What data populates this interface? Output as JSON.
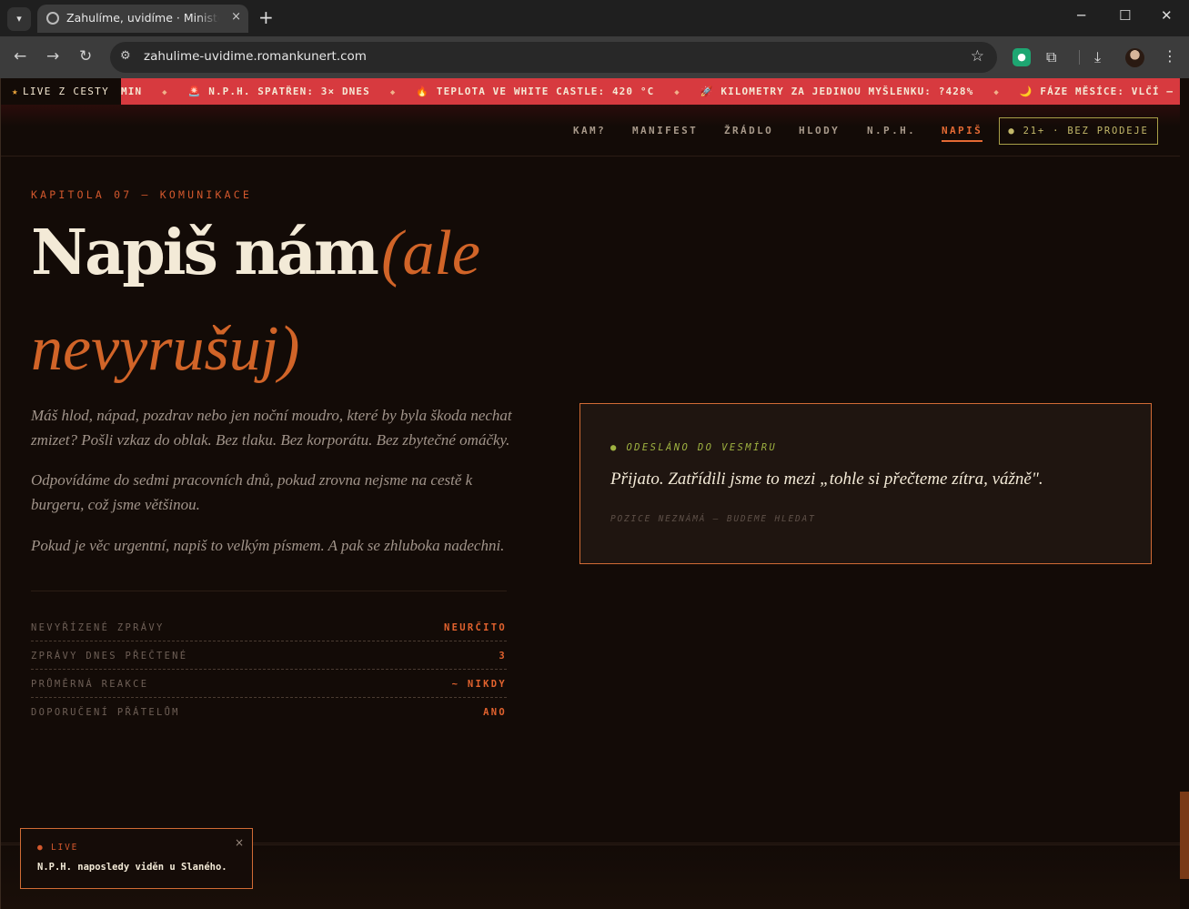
{
  "browser": {
    "tab_title": "Zahulíme, uvidíme · Ministerstvo",
    "tab_close": "×",
    "new_tab": "+",
    "url": "zahulime-uvidime.romankunert.com",
    "win_min": "─",
    "win_max": "☐",
    "win_close": "✕"
  },
  "ticker": {
    "label": "LIVE Z CESTY",
    "items": [
      "MIN",
      "🚨 N.P.H. SPATŘEN: 3× DNES",
      "🔥 TEPLOTA VE WHITE CASTLE: 420 °C",
      "🚀 KILOMETRY ZA JEDINOU MYŠLENKU: ?428%",
      "🌙 FÁZE MĚSÍCE: VLČÍ —"
    ]
  },
  "nav": {
    "items": [
      "KAM?",
      "MANIFEST",
      "ŽRÁDLO",
      "HLODY",
      "N.P.H.",
      "NAPIŠ"
    ],
    "active": "NAPIŠ",
    "age_badge": "● 21+ · BEZ PRODEJE"
  },
  "hero": {
    "kicker": "KAPITOLA 07 — KOMUNIKACE",
    "title": "Napiš nám",
    "title_aside": "(ale nevyrušuj)"
  },
  "paragraphs": [
    "Máš hlod, nápad, pozdrav nebo jen noční moudro, které by byla škoda nechat zmizet? Pošli vzkaz do oblak. Bez tlaku. Bez korporátu. Bez zbytečné omáčky.",
    "Odpovídáme do sedmi pracovních dnů, pokud zrovna nejsme na cestě k burgeru, což jsme většinou.",
    "Pokud je věc urgentní, napiš to velkým písmem. A pak se zhluboka nadechni."
  ],
  "stats": [
    {
      "label": "NEVYŘÍZENÉ ZPRÁVY",
      "value": "NEURČITO"
    },
    {
      "label": "ZPRÁVY DNES PŘEČTENÉ",
      "value": "3"
    },
    {
      "label": "PRŮMĚRNÁ REAKCE",
      "value": "~ NIKDY"
    },
    {
      "label": "DOPORUČENÍ PŘÁTELŮM",
      "value": "ANO"
    }
  ],
  "sent": {
    "label": "● ODESLÁNO DO VESMÍRU",
    "message": "Přijato. Zatřídili jsme to mezi „tohle si přečteme zítra, vážně\".",
    "position": "POZICE NEZNÁMÁ — BUDEME HLEDAT"
  },
  "toast": {
    "label": "● LIVE",
    "message": "N.P.H. naposledy viděn u Slaného.",
    "close": "×"
  },
  "colors": {
    "accent": "#d16428",
    "ticker_bg": "#d73a3f",
    "bg": "#130b07",
    "cream": "#f3ead7",
    "olive": "#a89f48"
  }
}
